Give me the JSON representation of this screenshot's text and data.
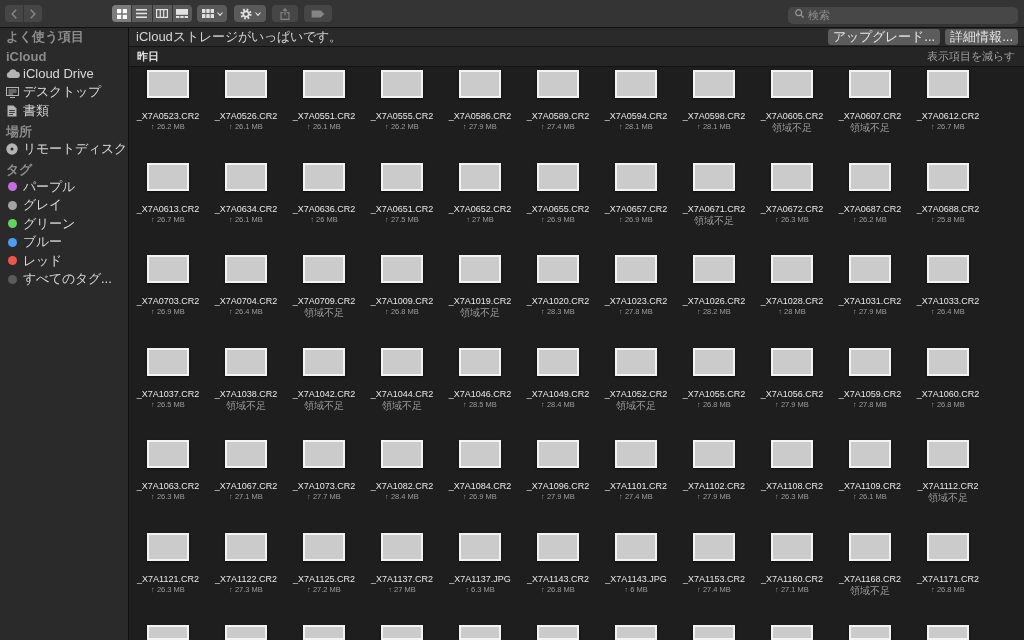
{
  "toolbar": {
    "nav_buttons": [
      {
        "kind": "back",
        "disabled": true
      },
      {
        "kind": "forward",
        "disabled": true
      }
    ],
    "view_modes": [
      {
        "kind": "icons",
        "selected": true
      },
      {
        "kind": "list",
        "selected": false
      },
      {
        "kind": "columns",
        "selected": false
      },
      {
        "kind": "gallery",
        "selected": false
      }
    ],
    "tools": [
      {
        "kind": "group",
        "disabled": false
      },
      {
        "kind": "action",
        "disabled": false
      },
      {
        "kind": "share",
        "disabled": true
      },
      {
        "kind": "tag",
        "disabled": true
      }
    ],
    "search": {
      "placeholder": "検索"
    }
  },
  "sidebar": {
    "sections": [
      {
        "title": "よく使う項目"
      },
      {
        "title": "iCloud",
        "items": [
          {
            "kind": "cloud",
            "label": "iCloud Drive"
          },
          {
            "kind": "desktop",
            "label": "デスクトップ"
          },
          {
            "kind": "document",
            "label": "書類"
          }
        ]
      },
      {
        "title": "場所",
        "items": [
          {
            "kind": "disc",
            "label": "リモートディスク"
          }
        ]
      },
      {
        "title": "タグ",
        "items": [
          {
            "kind": "tag",
            "label": "パープル",
            "color": "#c56ce5"
          },
          {
            "kind": "tag",
            "label": "グレイ",
            "color": "#a3a3a3"
          },
          {
            "kind": "tag",
            "label": "グリーン",
            "color": "#63d462"
          },
          {
            "kind": "tag",
            "label": "ブルー",
            "color": "#4b9cf5"
          },
          {
            "kind": "tag",
            "label": "レッド",
            "color": "#f0554b"
          },
          {
            "kind": "tag",
            "label": "すべてのタグ...",
            "color": "#5b5b5b"
          }
        ]
      }
    ]
  },
  "banner": {
    "message": "iCloudストレージがいっぱいです。",
    "buttons": [
      "アップグレード...",
      "詳細情報..."
    ]
  },
  "section": {
    "title": "昨日",
    "toggle": "表示項目を減らす"
  },
  "files": [
    {
      "kind": "photo",
      "name": "_X7A0523.CR2",
      "size": "↑ 26.2 MB"
    },
    {
      "kind": "photo",
      "name": "_X7A0526.CR2",
      "size": "↑ 26.1 MB"
    },
    {
      "kind": "photo",
      "name": "_X7A0551.CR2",
      "size": "↑ 26.1 MB"
    },
    {
      "kind": "photo",
      "name": "_X7A0555.CR2",
      "size": "↑ 26.2 MB"
    },
    {
      "kind": "photo",
      "name": "_X7A0586.CR2",
      "size": "↑ 27.9 MB"
    },
    {
      "kind": "photo",
      "name": "_X7A0589.CR2",
      "size": "↑ 27.4 MB"
    },
    {
      "kind": "photo",
      "name": "_X7A0594.CR2",
      "size": "↑ 28.1 MB"
    },
    {
      "kind": "photo",
      "name": "_X7A0598.CR2",
      "size": "↑ 28.1 MB"
    },
    {
      "kind": "photo",
      "name": "_X7A0605.CR2",
      "status": "領域不足"
    },
    {
      "kind": "photo",
      "name": "_X7A0607.CR2",
      "status": "領域不足"
    },
    {
      "kind": "photo",
      "name": "_X7A0612.CR2",
      "size": "↑ 26.7 MB"
    },
    {
      "kind": "photo",
      "name": "_X7A0613.CR2",
      "size": "↑ 26.7 MB"
    },
    {
      "kind": "photo",
      "name": "_X7A0634.CR2",
      "size": "↑ 26.1 MB"
    },
    {
      "kind": "photo",
      "name": "_X7A0636.CR2",
      "size": "↑ 26 MB"
    },
    {
      "kind": "photo",
      "name": "_X7A0651.CR2",
      "size": "↑ 27.5 MB"
    },
    {
      "kind": "photo",
      "name": "_X7A0652.CR2",
      "size": "↑ 27 MB"
    },
    {
      "kind": "photo",
      "name": "_X7A0655.CR2",
      "size": "↑ 26.9 MB"
    },
    {
      "kind": "photo",
      "name": "_X7A0657.CR2",
      "size": "↑ 26.9 MB"
    },
    {
      "kind": "photo",
      "name": "_X7A0671.CR2",
      "status": "領域不足"
    },
    {
      "kind": "photo",
      "name": "_X7A0672.CR2",
      "size": "↑ 26.3 MB"
    },
    {
      "kind": "photo",
      "name": "_X7A0687.CR2",
      "size": "↑ 26.2 MB"
    },
    {
      "kind": "photo",
      "name": "_X7A0688.CR2",
      "size": "↑ 25.8 MB"
    },
    {
      "kind": "photo",
      "name": "_X7A0703.CR2",
      "size": "↑ 26.9 MB"
    },
    {
      "kind": "photo",
      "name": "_X7A0704.CR2",
      "size": "↑ 26.4 MB"
    },
    {
      "kind": "photo",
      "name": "_X7A0709.CR2",
      "status": "領域不足"
    },
    {
      "kind": "photo",
      "name": "_X7A1009.CR2",
      "size": "↑ 26.8 MB"
    },
    {
      "kind": "photo",
      "name": "_X7A1019.CR2",
      "status": "領域不足"
    },
    {
      "kind": "photo",
      "name": "_X7A1020.CR2",
      "size": "↑ 28.3 MB"
    },
    {
      "kind": "photo",
      "name": "_X7A1023.CR2",
      "size": "↑ 27.8 MB"
    },
    {
      "kind": "photo",
      "name": "_X7A1026.CR2",
      "size": "↑ 28.2 MB"
    },
    {
      "kind": "photo",
      "name": "_X7A1028.CR2",
      "size": "↑ 28 MB"
    },
    {
      "kind": "photo",
      "name": "_X7A1031.CR2",
      "size": "↑ 27.9 MB"
    },
    {
      "kind": "photo",
      "name": "_X7A1033.CR2",
      "size": "↑ 26.4 MB"
    },
    {
      "kind": "photo",
      "name": "_X7A1037.CR2",
      "size": "↑ 26.5 MB"
    },
    {
      "kind": "photo",
      "name": "_X7A1038.CR2",
      "status": "領域不足"
    },
    {
      "kind": "photo",
      "name": "_X7A1042.CR2",
      "status": "領域不足"
    },
    {
      "kind": "photo",
      "name": "_X7A1044.CR2",
      "status": "領域不足"
    },
    {
      "kind": "photo",
      "name": "_X7A1046.CR2",
      "size": "↑ 28.5 MB"
    },
    {
      "kind": "photo",
      "name": "_X7A1049.CR2",
      "size": "↑ 28.4 MB"
    },
    {
      "kind": "photo",
      "name": "_X7A1052.CR2",
      "status": "領域不足"
    },
    {
      "kind": "photo",
      "name": "_X7A1055.CR2",
      "size": "↑ 26.8 MB"
    },
    {
      "kind": "photo",
      "name": "_X7A1056.CR2",
      "size": "↑ 27.9 MB"
    },
    {
      "kind": "photo",
      "name": "_X7A1059.CR2",
      "size": "↑ 27.8 MB"
    },
    {
      "kind": "photo",
      "name": "_X7A1060.CR2",
      "size": "↑ 26.8 MB"
    },
    {
      "kind": "photo",
      "name": "_X7A1063.CR2",
      "size": "↑ 26.3 MB"
    },
    {
      "kind": "photo",
      "name": "_X7A1067.CR2",
      "size": "↑ 27.1 MB"
    },
    {
      "kind": "photo",
      "name": "_X7A1073.CR2",
      "size": "↑ 27.7 MB"
    },
    {
      "kind": "photo",
      "name": "_X7A1082.CR2",
      "size": "↑ 28.4 MB"
    },
    {
      "kind": "photo",
      "name": "_X7A1084.CR2",
      "size": "↑ 26.9 MB"
    },
    {
      "kind": "photo",
      "name": "_X7A1096.CR2",
      "size": "↑ 27.9 MB"
    },
    {
      "kind": "photo",
      "name": "_X7A1101.CR2",
      "size": "↑ 27.4 MB"
    },
    {
      "kind": "photo",
      "name": "_X7A1102.CR2",
      "size": "↑ 27.9 MB"
    },
    {
      "kind": "photo",
      "name": "_X7A1108.CR2",
      "size": "↑ 26.3 MB"
    },
    {
      "kind": "photo",
      "name": "_X7A1109.CR2",
      "size": "↑ 26.1 MB"
    },
    {
      "kind": "photo",
      "name": "_X7A1112.CR2",
      "status": "領域不足"
    },
    {
      "kind": "photo",
      "name": "_X7A1121.CR2",
      "size": "↑ 26.3 MB"
    },
    {
      "kind": "photo",
      "name": "_X7A1122.CR2",
      "size": "↑ 27.3 MB"
    },
    {
      "kind": "photo",
      "name": "_X7A1125.CR2",
      "size": "↑ 27.2 MB"
    },
    {
      "kind": "photo",
      "name": "_X7A1137.CR2",
      "size": "↑ 27 MB"
    },
    {
      "kind": "photo",
      "name": "_X7A1137.JPG",
      "size": "↑ 6.3 MB"
    },
    {
      "kind": "photo",
      "name": "_X7A1143.CR2",
      "size": "↑ 26.8 MB"
    },
    {
      "kind": "photo",
      "name": "_X7A1143.JPG",
      "size": "↑ 6 MB"
    },
    {
      "kind": "photo",
      "name": "_X7A1153.CR2",
      "size": "↑ 27.4 MB"
    },
    {
      "kind": "photo",
      "name": "_X7A1160.CR2",
      "size": "↑ 27.1 MB"
    },
    {
      "kind": "photo",
      "name": "_X7A1168.CR2",
      "status": "領域不足"
    },
    {
      "kind": "photo",
      "name": "_X7A1171.CR2",
      "size": "↑ 26.8 MB"
    },
    {
      "kind": "photo"
    },
    {
      "kind": "photo"
    },
    {
      "kind": "photo"
    },
    {
      "kind": "photo"
    },
    {
      "kind": "photo"
    },
    {
      "kind": "photo"
    },
    {
      "kind": "photo"
    },
    {
      "kind": "photo"
    },
    {
      "kind": "photo"
    },
    {
      "kind": "photo"
    },
    {
      "kind": "photo"
    }
  ]
}
